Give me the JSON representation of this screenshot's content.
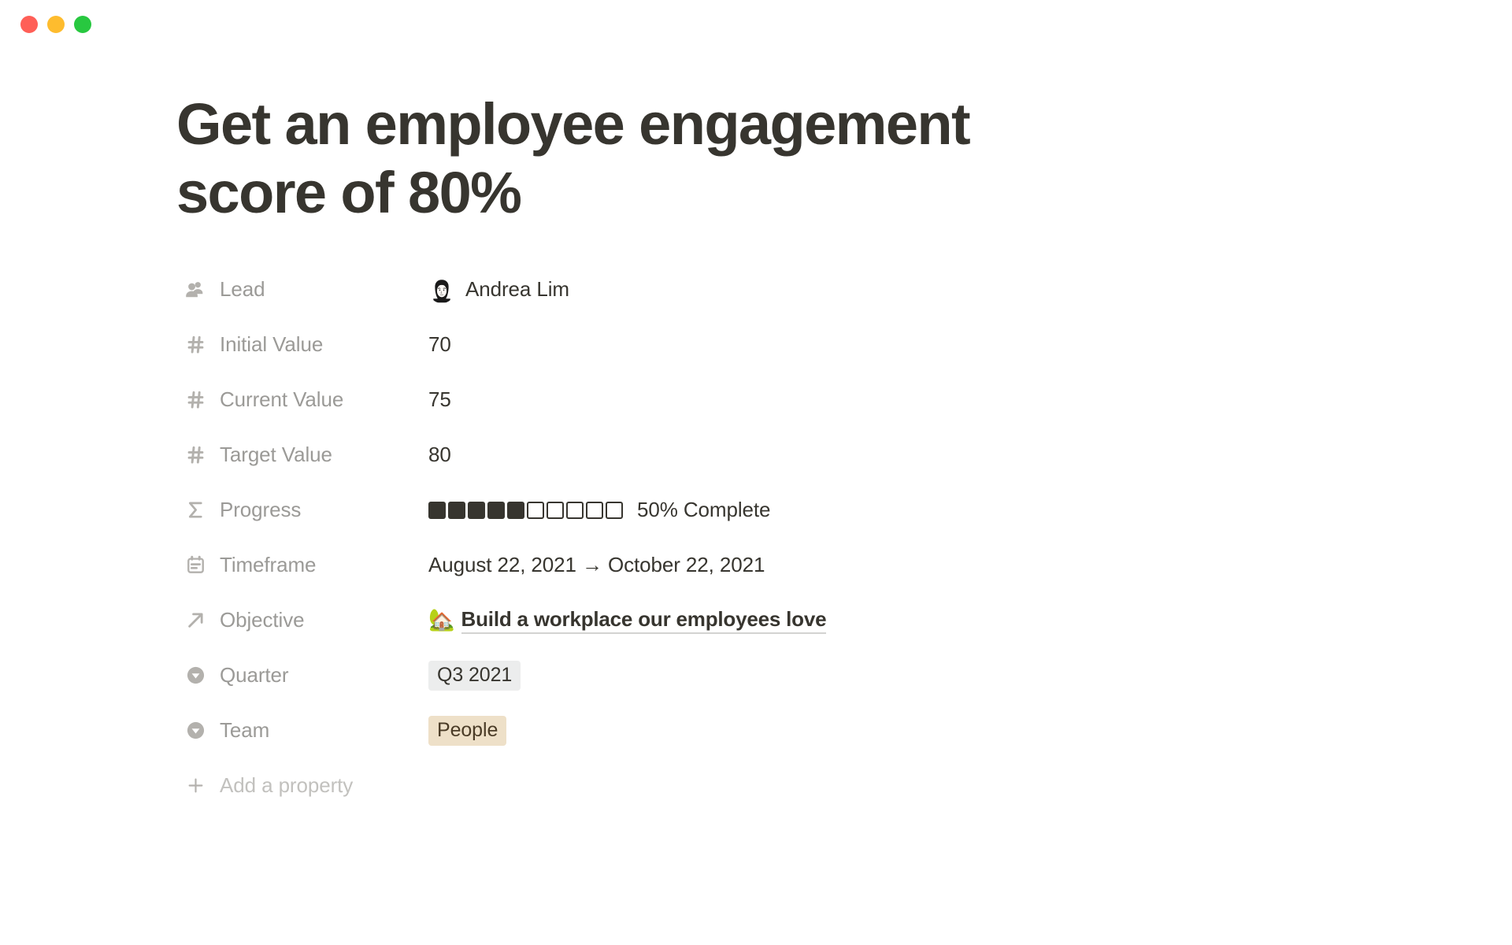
{
  "window": {
    "controls": [
      {
        "name": "close",
        "color": "#ff5f57"
      },
      {
        "name": "minimize",
        "color": "#febc2e"
      },
      {
        "name": "maximize",
        "color": "#28c840"
      }
    ]
  },
  "page": {
    "title": "Get an employee engagement score of 80%",
    "add_property_label": "Add a property"
  },
  "properties": [
    {
      "icon": "person-icon",
      "label": "Lead",
      "type": "person",
      "value": "Andrea Lim"
    },
    {
      "icon": "number-hash-icon",
      "label": "Initial Value",
      "type": "number",
      "value": "70"
    },
    {
      "icon": "number-hash-icon",
      "label": "Current Value",
      "type": "number",
      "value": "75"
    },
    {
      "icon": "number-hash-icon",
      "label": "Target Value",
      "type": "number",
      "value": "80"
    },
    {
      "icon": "sigma-formula-icon",
      "label": "Progress",
      "type": "progress",
      "value": "50% Complete"
    },
    {
      "icon": "calendar-icon",
      "label": "Timeframe",
      "type": "date",
      "value": "August 22, 2021 → October 22, 2021"
    },
    {
      "icon": "relation-arrow-icon",
      "label": "Objective",
      "type": "relation",
      "value": "Build a workplace our employees love",
      "emoji": "🏡"
    },
    {
      "icon": "select-icon",
      "label": "Quarter",
      "type": "select",
      "value": "Q3 2021"
    },
    {
      "icon": "select-icon",
      "label": "Team",
      "type": "select",
      "value": "People"
    }
  ],
  "progress": {
    "filled_squares": 5,
    "empty_squares": 5,
    "percent": 50,
    "text": "50% Complete"
  },
  "colors": {
    "title_text": "#37352f",
    "label_text": "#9b9a97",
    "icon": "#b3b1ad",
    "tag_default_bg": "#eceded",
    "tag_beige_bg": "#eee0c8",
    "tag_beige_text": "#4a3b26",
    "page_bg": "#ffffff"
  }
}
